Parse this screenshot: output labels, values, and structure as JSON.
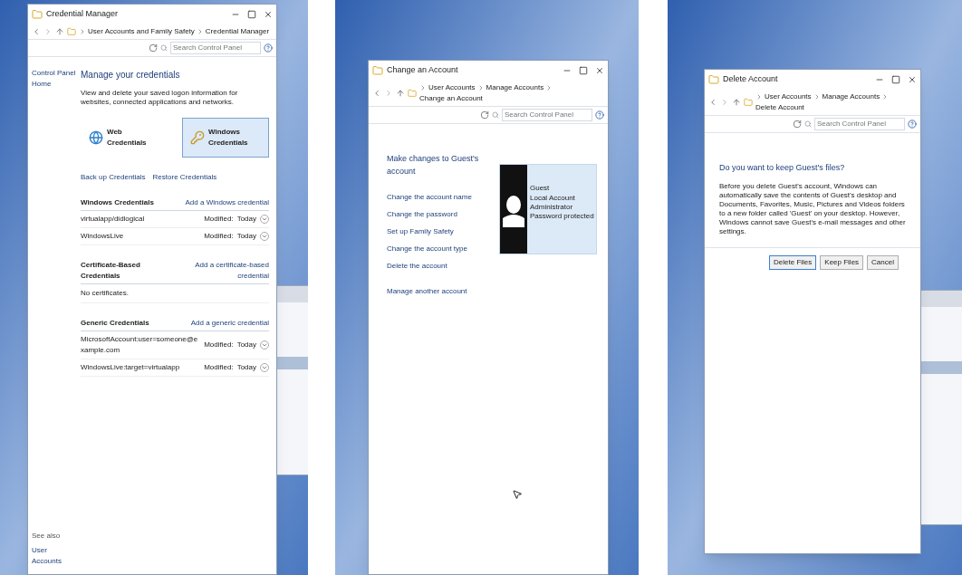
{
  "panels": [
    {
      "kind": "credentials",
      "window": {
        "title": "Credential Manager"
      },
      "breadcrumb": [
        "User Accounts and Family Safety",
        "Credential Manager"
      ],
      "search": {
        "placeholder": "Search Control Panel"
      },
      "sidebar": {
        "home": "Control Panel Home",
        "see_also": "See also",
        "links": [
          "User Accounts"
        ]
      },
      "heading": "Manage your credentials",
      "description": "View and delete your saved logon information for websites, connected applications and networks.",
      "tiles": [
        {
          "label": "Web Credentials",
          "selected": false
        },
        {
          "label": "Windows Credentials",
          "selected": true
        }
      ],
      "actions": [
        "Back up Credentials",
        "Restore Credentials"
      ],
      "sections": [
        {
          "title": "Windows Credentials",
          "add": "Add a Windows credential",
          "rows": [
            {
              "name": "virtualapp/didlogical",
              "modified": "Modified:",
              "date": "Today"
            },
            {
              "name": "WindowsLive",
              "modified": "Modified:",
              "date": "Today"
            }
          ]
        },
        {
          "title": "Certificate-Based Credentials",
          "add": "Add a certificate-based credential",
          "empty": "No certificates."
        },
        {
          "title": "Generic Credentials",
          "add": "Add a generic credential",
          "rows": [
            {
              "name": "MicrosoftAccount:user=someone@example.com",
              "modified": "Modified:",
              "date": "Today"
            },
            {
              "name": "WindowsLive:target=virtualapp",
              "modified": "Modified:",
              "date": "Today"
            }
          ]
        }
      ]
    },
    {
      "kind": "account",
      "window": {
        "title": "Change an Account"
      },
      "breadcrumb": [
        "User Accounts",
        "Manage Accounts",
        "Change an Account"
      ],
      "search": {
        "placeholder": "Search Control Panel"
      },
      "heading": "Make changes to Guest's account",
      "links": [
        "Change the account name",
        "Change the password",
        "Set up Family Safety",
        "Change the account type",
        "Delete the account"
      ],
      "other_link": "Manage another account",
      "account": {
        "name": "Guest",
        "details": [
          "Local Account",
          "Administrator",
          "Password protected"
        ]
      }
    },
    {
      "kind": "delete",
      "window": {
        "title": "Delete Account"
      },
      "breadcrumb": [
        "User Accounts",
        "Manage Accounts",
        "Delete Account"
      ],
      "search": {
        "placeholder": "Search Control Panel"
      },
      "heading": "Do you want to keep Guest's files?",
      "description": "Before you delete Guest's account, Windows can automatically save the contents of Guest's desktop and Documents, Favorites, Music, Pictures and Videos folders to a new folder called 'Guest' on your desktop. However, Windows cannot save Guest's e-mail messages and other settings.",
      "buttons": [
        {
          "label": "Delete Files",
          "selected": true
        },
        {
          "label": "Keep Files",
          "selected": false
        },
        {
          "label": "Cancel",
          "selected": false
        }
      ]
    }
  ]
}
